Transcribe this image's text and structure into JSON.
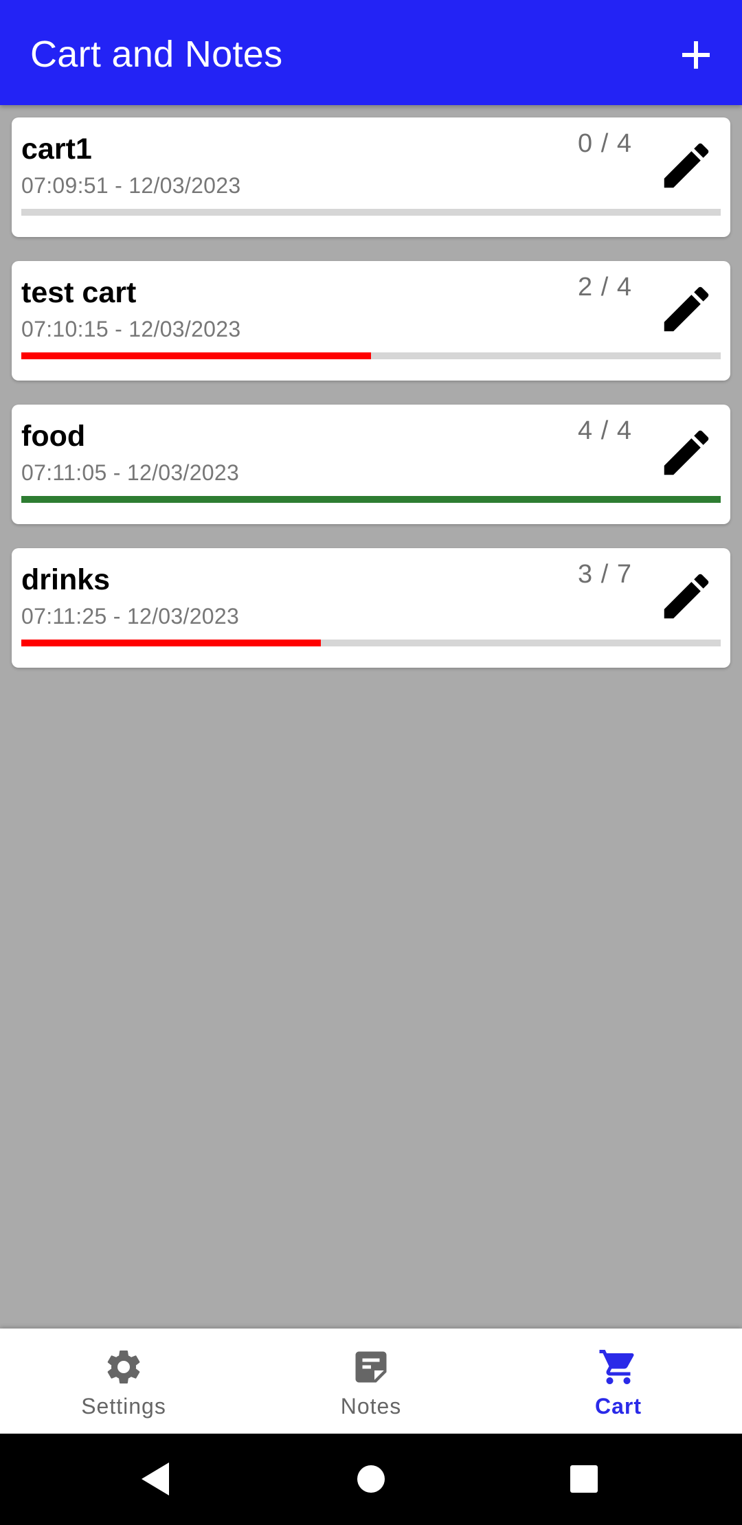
{
  "app_bar": {
    "title": "Cart and Notes",
    "add_icon": "plus-icon",
    "color": "#2323f5"
  },
  "carts": [
    {
      "name": "cart1",
      "date": "07:09:51 - 12/03/2023",
      "count": "0 / 4",
      "progress": 0.0,
      "progress_color": "#ff0000"
    },
    {
      "name": "test cart",
      "date": "07:10:15 - 12/03/2023",
      "count": "2 / 4",
      "progress": 0.5,
      "progress_color": "#ff0000"
    },
    {
      "name": "food",
      "date": "07:11:05 - 12/03/2023",
      "count": "4 / 4",
      "progress": 1.0,
      "progress_color": "#2e7d32"
    },
    {
      "name": "drinks",
      "date": "07:11:25 - 12/03/2023",
      "count": "3 / 7",
      "progress": 0.4286,
      "progress_color": "#ff0000"
    }
  ],
  "bottom_nav": {
    "items": [
      {
        "label": "Settings",
        "icon": "gear-icon",
        "active": false
      },
      {
        "label": "Notes",
        "icon": "notes-icon",
        "active": false
      },
      {
        "label": "Cart",
        "icon": "cart-icon",
        "active": true
      }
    ],
    "active_color": "#2a2ae8"
  }
}
